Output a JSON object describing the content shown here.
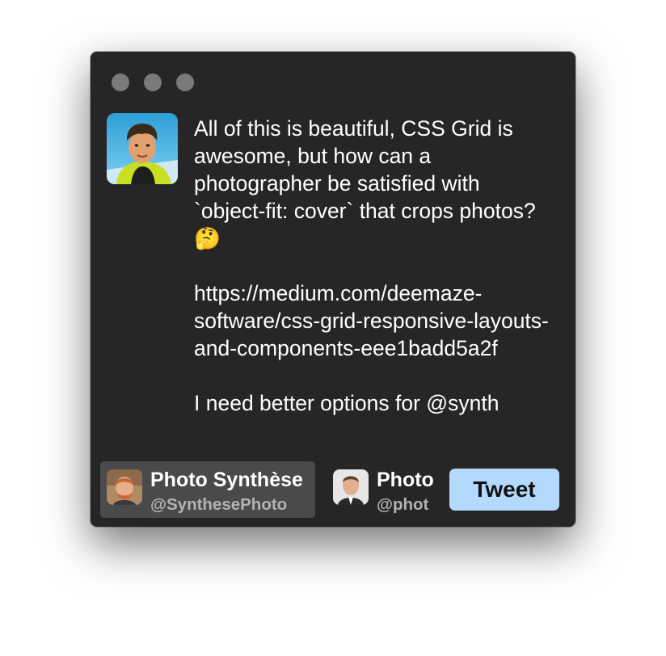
{
  "window": {
    "controls": [
      "close",
      "minimize",
      "zoom"
    ]
  },
  "tweet": {
    "author_avatar": "user-avatar-photo",
    "text": "All of this is beautiful, CSS Grid is awesome, but how can a photographer be satisfied with `object-fit: cover` that crops photos? 🤔\n\nhttps://medium.com/deemaze-software/css-grid-responsive-layouts-and-components-eee1badd5a2f\n\nI need better options for @synth"
  },
  "accounts": [
    {
      "name": "Photo Synthèse",
      "handle": "@SynthesePhoto",
      "selected": true
    },
    {
      "name": "Photo",
      "handle": "@phot",
      "selected": false
    }
  ],
  "actions": {
    "tweet_label": "Tweet"
  },
  "colors": {
    "window_bg": "#262626",
    "selected_account_bg": "#4a4a4c",
    "tweet_button_bg": "#b3d9ff",
    "traffic_light": "#7a7a7a"
  }
}
